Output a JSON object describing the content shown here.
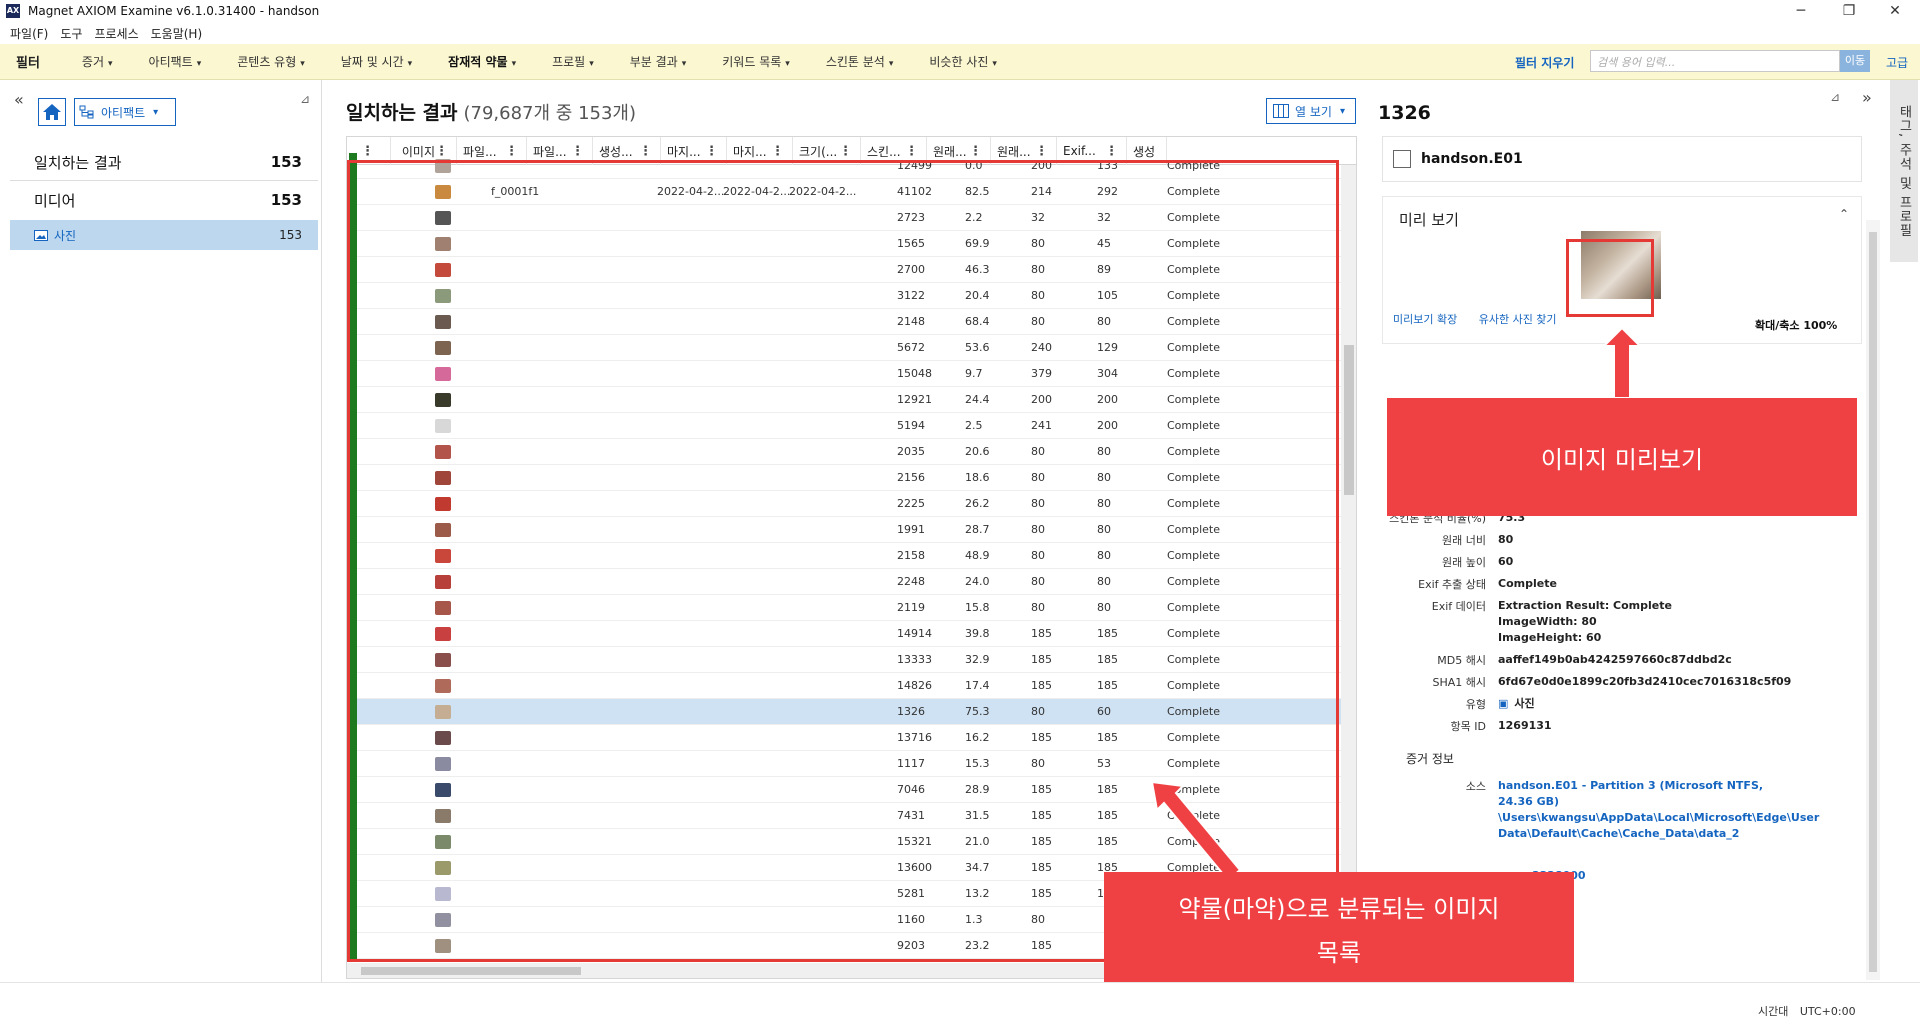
{
  "window": {
    "title": "Magnet AXIOM Examine v6.1.0.31400 - handson",
    "logo": "AX",
    "minimize": "─",
    "maximize": "❐",
    "close": "✕"
  },
  "menu": [
    "파일(F)",
    "도구",
    "프로세스",
    "도움말(H)"
  ],
  "filterbar": {
    "label": "필터",
    "items": [
      {
        "label": "증거",
        "bold": false
      },
      {
        "label": "아티팩트",
        "bold": false
      },
      {
        "label": "콘텐츠 유형",
        "bold": false
      },
      {
        "label": "날짜 및 시간",
        "bold": false
      },
      {
        "label": "잠재적 약물",
        "bold": true
      },
      {
        "label": "프로필",
        "bold": false
      },
      {
        "label": "부분 결과",
        "bold": false
      },
      {
        "label": "키워드 목록",
        "bold": false
      },
      {
        "label": "스킨톤 분석",
        "bold": false
      },
      {
        "label": "비슷한 사진",
        "bold": false
      }
    ],
    "caret": "▾",
    "clear": "필터 지우기",
    "search_placeholder": "검색 용어 입력...",
    "go": "이동",
    "advanced": "고급"
  },
  "left": {
    "collapse": "«",
    "artifact_btn": "아티팩트",
    "pin": "⊿",
    "matching": {
      "label": "일치하는 결과",
      "count": "153"
    },
    "media": {
      "label": "미디어",
      "count": "153"
    },
    "photo": {
      "label": "사진",
      "count": "153"
    }
  },
  "center": {
    "title": "일치하는 결과",
    "subtitle": "(79,687개 중 153개)",
    "col_view": "열 보기",
    "headers": [
      "이미지",
      "파일...",
      "파일...",
      "생성...",
      "마지...",
      "마지...",
      "크기(...",
      "스킨...",
      "원래...",
      "원래...",
      "Exif...",
      "생성"
    ],
    "rows": [
      {
        "name": "",
        "created": "",
        "mod1": "",
        "mod2": "",
        "size": "12499",
        "skin": "0.0",
        "w": "200",
        "h": "133",
        "exif": "Complete",
        "color": "#b0a39a"
      },
      {
        "name": "f_0001f1",
        "created": "2022-04-2...",
        "mod1": "2022-04-2...",
        "mod2": "2022-04-2...",
        "size": "41102",
        "skin": "82.5",
        "w": "214",
        "h": "292",
        "exif": "Complete",
        "color": "#c98a3f"
      },
      {
        "name": "",
        "created": "",
        "mod1": "",
        "mod2": "",
        "size": "2723",
        "skin": "2.2",
        "w": "32",
        "h": "32",
        "exif": "Complete",
        "color": "#555555"
      },
      {
        "name": "",
        "created": "",
        "mod1": "",
        "mod2": "",
        "size": "1565",
        "skin": "69.9",
        "w": "80",
        "h": "45",
        "exif": "Complete",
        "color": "#a08070"
      },
      {
        "name": "",
        "created": "",
        "mod1": "",
        "mod2": "",
        "size": "2700",
        "skin": "46.3",
        "w": "80",
        "h": "89",
        "exif": "Complete",
        "color": "#c44b3c"
      },
      {
        "name": "",
        "created": "",
        "mod1": "",
        "mod2": "",
        "size": "3122",
        "skin": "20.4",
        "w": "80",
        "h": "105",
        "exif": "Complete",
        "color": "#8a9a7a"
      },
      {
        "name": "",
        "created": "",
        "mod1": "",
        "mod2": "",
        "size": "2148",
        "skin": "68.4",
        "w": "80",
        "h": "80",
        "exif": "Complete",
        "color": "#6b5a50"
      },
      {
        "name": "",
        "created": "",
        "mod1": "",
        "mod2": "",
        "size": "5672",
        "skin": "53.6",
        "w": "240",
        "h": "129",
        "exif": "Complete",
        "color": "#7d6450"
      },
      {
        "name": "",
        "created": "",
        "mod1": "",
        "mod2": "",
        "size": "15048",
        "skin": "9.7",
        "w": "379",
        "h": "304",
        "exif": "Complete",
        "color": "#d56a9a"
      },
      {
        "name": "",
        "created": "",
        "mod1": "",
        "mod2": "",
        "size": "12921",
        "skin": "24.4",
        "w": "200",
        "h": "200",
        "exif": "Complete",
        "color": "#3a3a2a"
      },
      {
        "name": "",
        "created": "",
        "mod1": "",
        "mod2": "",
        "size": "5194",
        "skin": "2.5",
        "w": "241",
        "h": "200",
        "exif": "Complete",
        "color": "#d8d8d8"
      },
      {
        "name": "",
        "created": "",
        "mod1": "",
        "mod2": "",
        "size": "2035",
        "skin": "20.6",
        "w": "80",
        "h": "80",
        "exif": "Complete",
        "color": "#b2544a"
      },
      {
        "name": "",
        "created": "",
        "mod1": "",
        "mod2": "",
        "size": "2156",
        "skin": "18.6",
        "w": "80",
        "h": "80",
        "exif": "Complete",
        "color": "#a0453a"
      },
      {
        "name": "",
        "created": "",
        "mod1": "",
        "mod2": "",
        "size": "2225",
        "skin": "26.2",
        "w": "80",
        "h": "80",
        "exif": "Complete",
        "color": "#c03a30"
      },
      {
        "name": "",
        "created": "",
        "mod1": "",
        "mod2": "",
        "size": "1991",
        "skin": "28.7",
        "w": "80",
        "h": "80",
        "exif": "Complete",
        "color": "#9c5a48"
      },
      {
        "name": "",
        "created": "",
        "mod1": "",
        "mod2": "",
        "size": "2158",
        "skin": "48.9",
        "w": "80",
        "h": "80",
        "exif": "Complete",
        "color": "#c8463a"
      },
      {
        "name": "",
        "created": "",
        "mod1": "",
        "mod2": "",
        "size": "2248",
        "skin": "24.0",
        "w": "80",
        "h": "80",
        "exif": "Complete",
        "color": "#b8403a"
      },
      {
        "name": "",
        "created": "",
        "mod1": "",
        "mod2": "",
        "size": "2119",
        "skin": "15.8",
        "w": "80",
        "h": "80",
        "exif": "Complete",
        "color": "#a8564a"
      },
      {
        "name": "",
        "created": "",
        "mod1": "",
        "mod2": "",
        "size": "14914",
        "skin": "39.8",
        "w": "185",
        "h": "185",
        "exif": "Complete",
        "color": "#c94040"
      },
      {
        "name": "",
        "created": "",
        "mod1": "",
        "mod2": "",
        "size": "13333",
        "skin": "32.9",
        "w": "185",
        "h": "185",
        "exif": "Complete",
        "color": "#8a4f4a"
      },
      {
        "name": "",
        "created": "",
        "mod1": "",
        "mod2": "",
        "size": "14826",
        "skin": "17.4",
        "w": "185",
        "h": "185",
        "exif": "Complete",
        "color": "#b06a5a"
      },
      {
        "name": "",
        "created": "",
        "mod1": "",
        "mod2": "",
        "size": "1326",
        "skin": "75.3",
        "w": "80",
        "h": "60",
        "exif": "Complete",
        "color": "#c4ad92",
        "selected": true
      },
      {
        "name": "",
        "created": "",
        "mod1": "",
        "mod2": "",
        "size": "13716",
        "skin": "16.2",
        "w": "185",
        "h": "185",
        "exif": "Complete",
        "color": "#6a4a4a"
      },
      {
        "name": "",
        "created": "",
        "mod1": "",
        "mod2": "",
        "size": "1117",
        "skin": "15.3",
        "w": "80",
        "h": "53",
        "exif": "Complete",
        "color": "#8a8aa0"
      },
      {
        "name": "",
        "created": "",
        "mod1": "",
        "mod2": "",
        "size": "7046",
        "skin": "28.9",
        "w": "185",
        "h": "185",
        "exif": "Complete",
        "color": "#3a4a6a"
      },
      {
        "name": "",
        "created": "",
        "mod1": "",
        "mod2": "",
        "size": "7431",
        "skin": "31.5",
        "w": "185",
        "h": "185",
        "exif": "Complete",
        "color": "#8a7a6a"
      },
      {
        "name": "",
        "created": "",
        "mod1": "",
        "mod2": "",
        "size": "15321",
        "skin": "21.0",
        "w": "185",
        "h": "185",
        "exif": "Complete",
        "color": "#7a8a6a"
      },
      {
        "name": "",
        "created": "",
        "mod1": "",
        "mod2": "",
        "size": "13600",
        "skin": "34.7",
        "w": "185",
        "h": "185",
        "exif": "Complete",
        "color": "#9a9a6a"
      },
      {
        "name": "",
        "created": "",
        "mod1": "",
        "mod2": "",
        "size": "5281",
        "skin": "13.2",
        "w": "185",
        "h": "185",
        "exif": "Complete",
        "color": "#b8b8d0"
      },
      {
        "name": "",
        "created": "",
        "mod1": "",
        "mod2": "",
        "size": "1160",
        "skin": "1.3",
        "w": "80",
        "h": "",
        "exif": "",
        "color": "#9090a0"
      },
      {
        "name": "",
        "created": "",
        "mod1": "",
        "mod2": "",
        "size": "9203",
        "skin": "23.2",
        "w": "185",
        "h": "",
        "exif": "",
        "color": "#a09080"
      }
    ]
  },
  "right": {
    "title": "1326",
    "pin": "⊿",
    "expand": "»",
    "evidence_file": "handson.E01",
    "preview_head": "미리 보기",
    "collapse": "⌃",
    "link_expand": "미리보기 확장",
    "link_similar": "유사한 사진 찾기",
    "zoom": "확대/축소 100%",
    "props": [
      {
        "k": "스킨톤 분석 비율(%)",
        "v": "75.3"
      },
      {
        "k": "원래 너비",
        "v": "80"
      },
      {
        "k": "원래 높이",
        "v": "60"
      },
      {
        "k": "Exif 추출 상태",
        "v": "Complete"
      },
      {
        "k": "Exif 데이터",
        "v": "Extraction Result: Complete\nImageWidth: 80\nImageHeight: 60"
      },
      {
        "k": "MD5 해시",
        "v": "aaffef149b0ab4242597660c87ddbd2c"
      },
      {
        "k": "SHA1 해시",
        "v": "6fd67e0d0e1899c20fb3d2410cec7016318c5f09"
      },
      {
        "k": "유형",
        "v": "사진"
      },
      {
        "k": "항목 ID",
        "v": "1269131"
      }
    ],
    "evidence_head": "증거 정보",
    "source_key": "소스",
    "source_value": "handson.E01 - Partition 3 (Microsoft NTFS, 24.36 GB) \\Users\\kwangsu\\AppData\\Local\\Microsoft\\Edge\\User Data\\Default\\Cache\\Cache_Data\\data_2",
    "offset_value": "3328000"
  },
  "side_tab": "태그, 주석 및 프로필",
  "callouts": {
    "preview": "이미지 미리보기",
    "list": "약물(마약)으로 분류되는 이미지 목록"
  },
  "status": {
    "tz_label": "시간대",
    "tz_value": "UTC+0:00"
  },
  "colors": {
    "accent": "#1565c0",
    "filterbar_bg": "#fbf7d1",
    "selected_row": "#cfe2f3",
    "row_strip": "#1e7a1e",
    "annotation_red": "#ef4044"
  }
}
